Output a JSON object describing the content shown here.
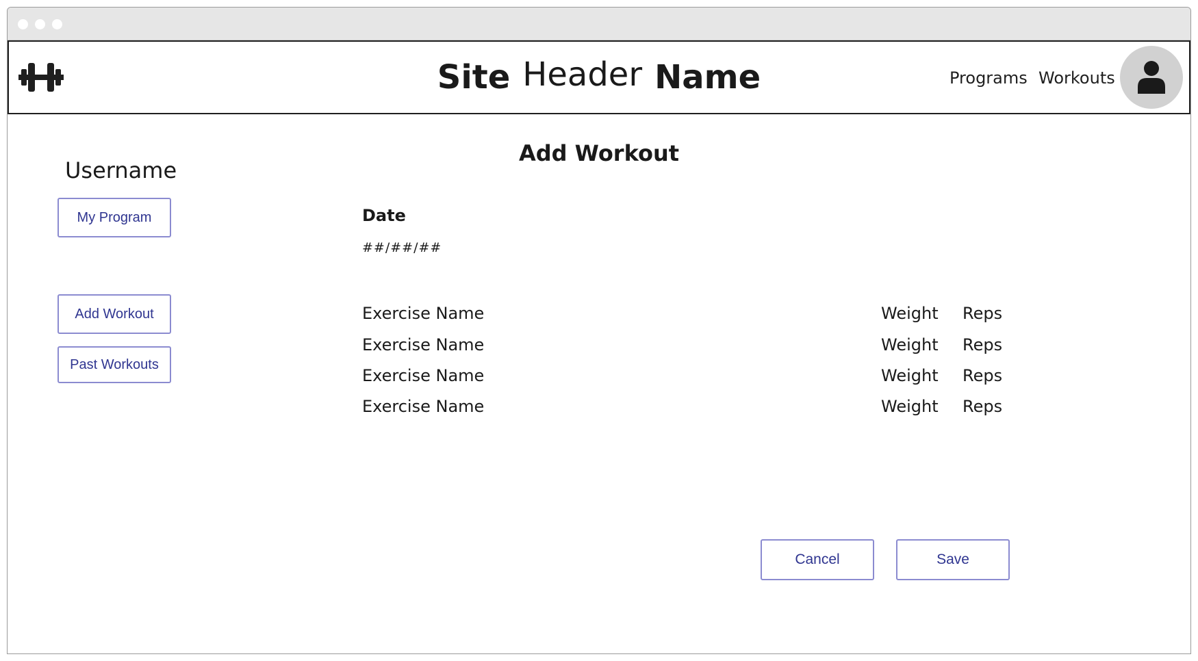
{
  "header": {
    "title_words": [
      "Site",
      "Header",
      "Name"
    ],
    "nav": [
      "Programs",
      "Workouts"
    ],
    "logo_icon": "barbell-icon",
    "avatar_icon": "user-icon"
  },
  "sidebar": {
    "username": "Username",
    "buttons": [
      "My Program",
      "Add Workout",
      "Past Workouts"
    ]
  },
  "main": {
    "title": "Add Workout",
    "date_label": "Date",
    "date_value": "##/##/##",
    "exercises": [
      {
        "name": "Exercise Name",
        "weight": "Weight",
        "reps": "Reps"
      },
      {
        "name": "Exercise Name",
        "weight": "Weight",
        "reps": "Reps"
      },
      {
        "name": "Exercise Name",
        "weight": "Weight",
        "reps": "Reps"
      },
      {
        "name": "Exercise Name",
        "weight": "Weight",
        "reps": "Reps"
      }
    ],
    "actions": {
      "cancel": "Cancel",
      "save": "Save"
    }
  },
  "colors": {
    "button_border": "#8b8bd0",
    "button_text": "#2f3590",
    "avatar_bg": "#d1d1d1",
    "titlebar_bg": "#e6e6e6"
  }
}
